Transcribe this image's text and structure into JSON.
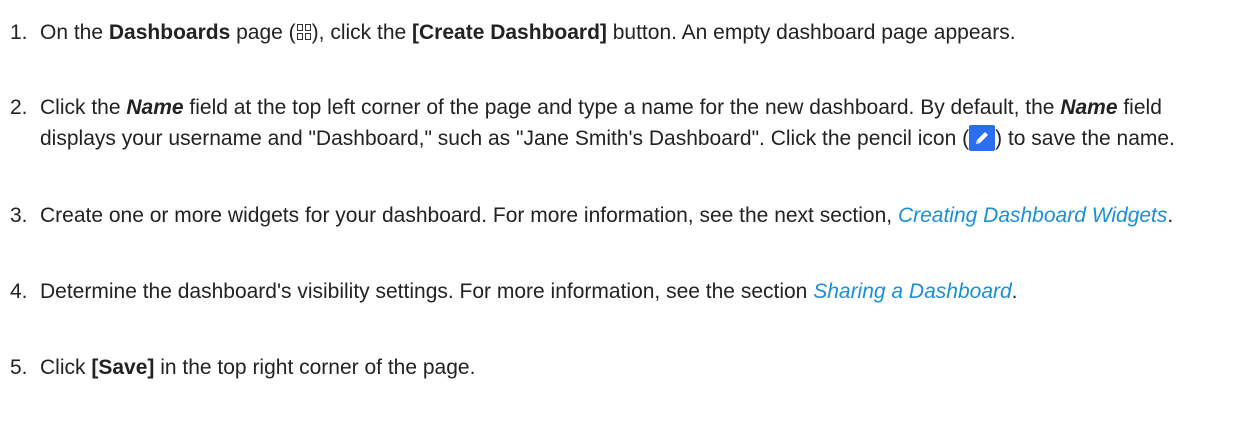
{
  "steps": [
    {
      "number": "1.",
      "parts": [
        {
          "t": "On the "
        },
        {
          "t": "Dashboards",
          "s": "b"
        },
        {
          "t": " page ("
        },
        {
          "icon": "dashboards-grid-icon"
        },
        {
          "t": "), click the "
        },
        {
          "t": "[Create Dashboard]",
          "s": "b"
        },
        {
          "t": " button. An empty dashboard page appears."
        }
      ]
    },
    {
      "number": "2.",
      "parts": [
        {
          "t": "Click the "
        },
        {
          "t": "Name",
          "s": "bi"
        },
        {
          "t": " field at the top left corner of the page and type a name for the new dashboard. By default, the "
        },
        {
          "t": "Name",
          "s": "bi"
        },
        {
          "t": " field displays your username and \"Dashboard,\" such as \"Jane Smith's Dashboard\". Click the pencil icon ("
        },
        {
          "icon": "pencil-icon"
        },
        {
          "t": ") to save the name."
        }
      ]
    },
    {
      "number": "3.",
      "parts": [
        {
          "t": "Create one or more widgets for your dashboard. For more information, see the next section, "
        },
        {
          "t": "Creating Dashboard Widgets",
          "s": "link"
        },
        {
          "t": "."
        }
      ]
    },
    {
      "number": "4.",
      "parts": [
        {
          "t": "Determine the dashboard's visibility settings. For more information, see the section "
        },
        {
          "t": "Sharing a Dashboard",
          "s": "link"
        },
        {
          "t": "."
        }
      ]
    },
    {
      "number": "5.",
      "parts": [
        {
          "t": "Click "
        },
        {
          "t": "[Save]",
          "s": "b"
        },
        {
          "t": " in the top right corner of the page."
        }
      ]
    }
  ],
  "colors": {
    "text": "#222222",
    "link": "#1a8fd6",
    "pencil_icon_bg": "#2b6ef2"
  }
}
